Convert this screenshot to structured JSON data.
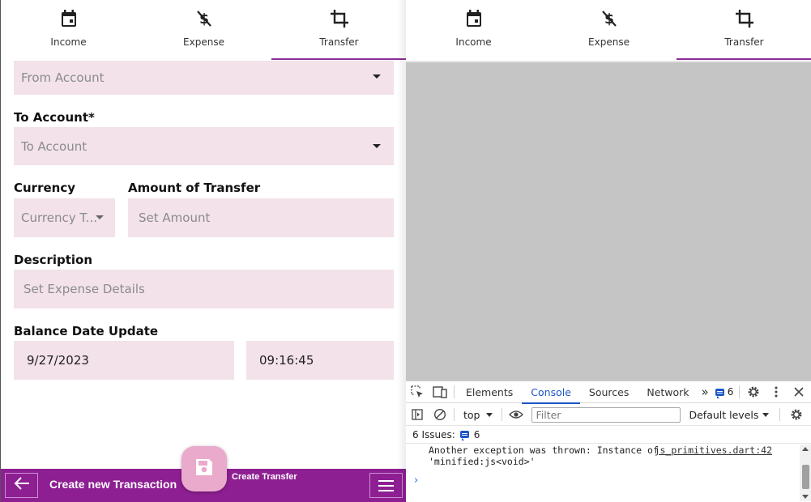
{
  "tabs": [
    {
      "label": "Income",
      "icon": "calendar-icon"
    },
    {
      "label": "Expense",
      "icon": "money-off-icon"
    },
    {
      "label": "Transfer",
      "icon": "crop-icon",
      "active": true
    }
  ],
  "form": {
    "from_account_placeholder": "From Account",
    "to_account_label": "To Account*",
    "to_account_placeholder": "To Account",
    "currency_label": "Currency",
    "currency_placeholder": "Currency T...",
    "amount_label": "Amount of Transfer",
    "amount_placeholder": "Set Amount",
    "description_label": "Description",
    "description_placeholder": "Set Expense Details",
    "balance_date_label": "Balance Date Update",
    "date_value": "9/27/2023",
    "time_value": "09:16:45"
  },
  "bottom_bar": {
    "title": "Create new Transaction",
    "fab_label": "Create Transfer"
  },
  "devtools": {
    "tabs": [
      "Elements",
      "Console",
      "Sources",
      "Network"
    ],
    "active_tab": "Console",
    "more_tabs": "»",
    "issues_badge": "6",
    "context": "top",
    "filter_placeholder": "Filter",
    "levels": "Default levels",
    "issues_label": "6 Issues:",
    "issues_count": "6",
    "message_line1": "Another exception was thrown: Instance of",
    "message_line2": "'minified:js<void>'",
    "message_source": "js_primitives.dart:42",
    "prompt": "›"
  },
  "colors": {
    "accent": "#8e1f93",
    "field_bg": "#f3e2ea",
    "fab_bg": "#eaaacc",
    "devtools_accent": "#1a56c4"
  }
}
